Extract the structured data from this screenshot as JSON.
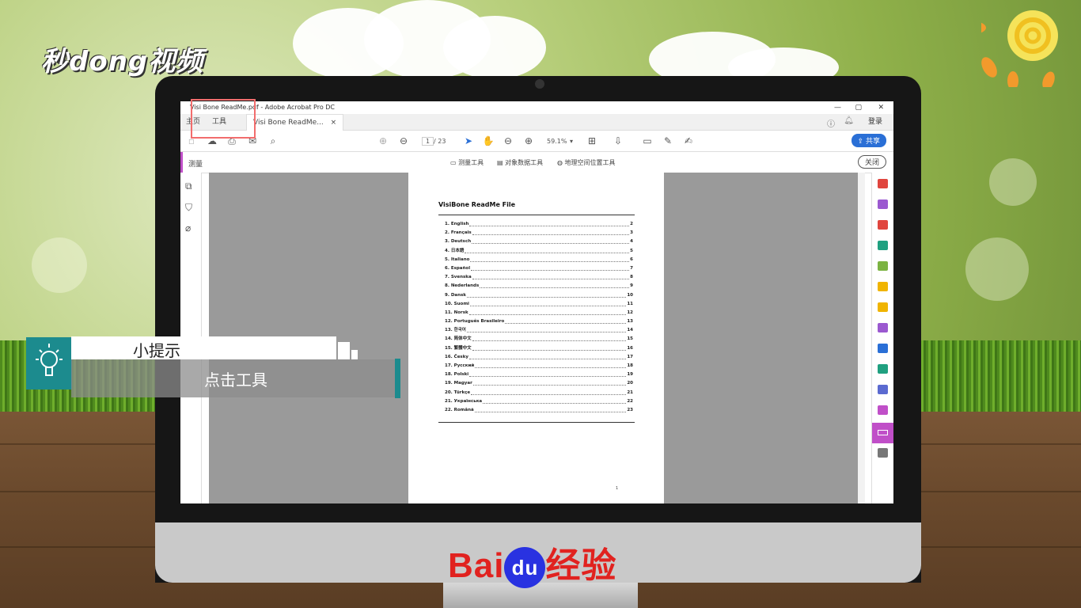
{
  "watermark": {
    "logo_text": "秒dong视频",
    "baidu_text": "Bai",
    "baidu_du": "du",
    "baidu_suffix": "经验"
  },
  "window": {
    "title": "Visi Bone ReadMe.pdf - Adobe Acrobat Pro DC",
    "minimize": "—",
    "maximize": "▢",
    "close": "✕"
  },
  "tabs": {
    "home": "主页",
    "tools": "工具",
    "document": "Visi Bone ReadMe...",
    "doc_close": "×",
    "login": "登录"
  },
  "toolbar": {
    "page_current": "1",
    "page_total": "/ 23",
    "zoom": "59.1%",
    "share": "共享"
  },
  "measure_bar": {
    "label": "测量",
    "measure_tool": "测量工具",
    "object_data_tool": "对象数据工具",
    "geo_tool": "地理空间位置工具",
    "close": "关闭"
  },
  "document": {
    "title": "VisiBone ReadMe File",
    "toc": [
      {
        "lang": "1.   English",
        "page": "2"
      },
      {
        "lang": "2.   Français",
        "page": "3"
      },
      {
        "lang": "3.   Deutsch",
        "page": "4"
      },
      {
        "lang": "4.   日本語",
        "page": "5"
      },
      {
        "lang": "5.   Italiano",
        "page": "6"
      },
      {
        "lang": "6.   Español",
        "page": "7"
      },
      {
        "lang": "7.   Svenska",
        "page": "8"
      },
      {
        "lang": "8.   Nederlands",
        "page": "9"
      },
      {
        "lang": "9.   Dansk",
        "page": "10"
      },
      {
        "lang": "10. Suomi",
        "page": "11"
      },
      {
        "lang": "11. Norsk",
        "page": "12"
      },
      {
        "lang": "12. Português Brasileiro",
        "page": "13"
      },
      {
        "lang": "13. 한국어",
        "page": "14"
      },
      {
        "lang": "14. 简体中文",
        "page": "15"
      },
      {
        "lang": "15. 繁體中文",
        "page": "16"
      },
      {
        "lang": "16. Česky",
        "page": "17"
      },
      {
        "lang": "17. Русский",
        "page": "18"
      },
      {
        "lang": "18. Polski",
        "page": "19"
      },
      {
        "lang": "19. Magyar",
        "page": "20"
      },
      {
        "lang": "20. Türkçe",
        "page": "21"
      },
      {
        "lang": "21. Українська",
        "page": "22"
      },
      {
        "lang": "22. Română",
        "page": "23"
      }
    ],
    "page_number": "1"
  },
  "tip": {
    "title": "小提示",
    "text": "点击工具"
  },
  "colors": {
    "accent_purple": "#c04fc8",
    "share_blue": "#2a6fd6",
    "teal": "#1c8b8e",
    "highlight_red": "#f26d6d"
  }
}
